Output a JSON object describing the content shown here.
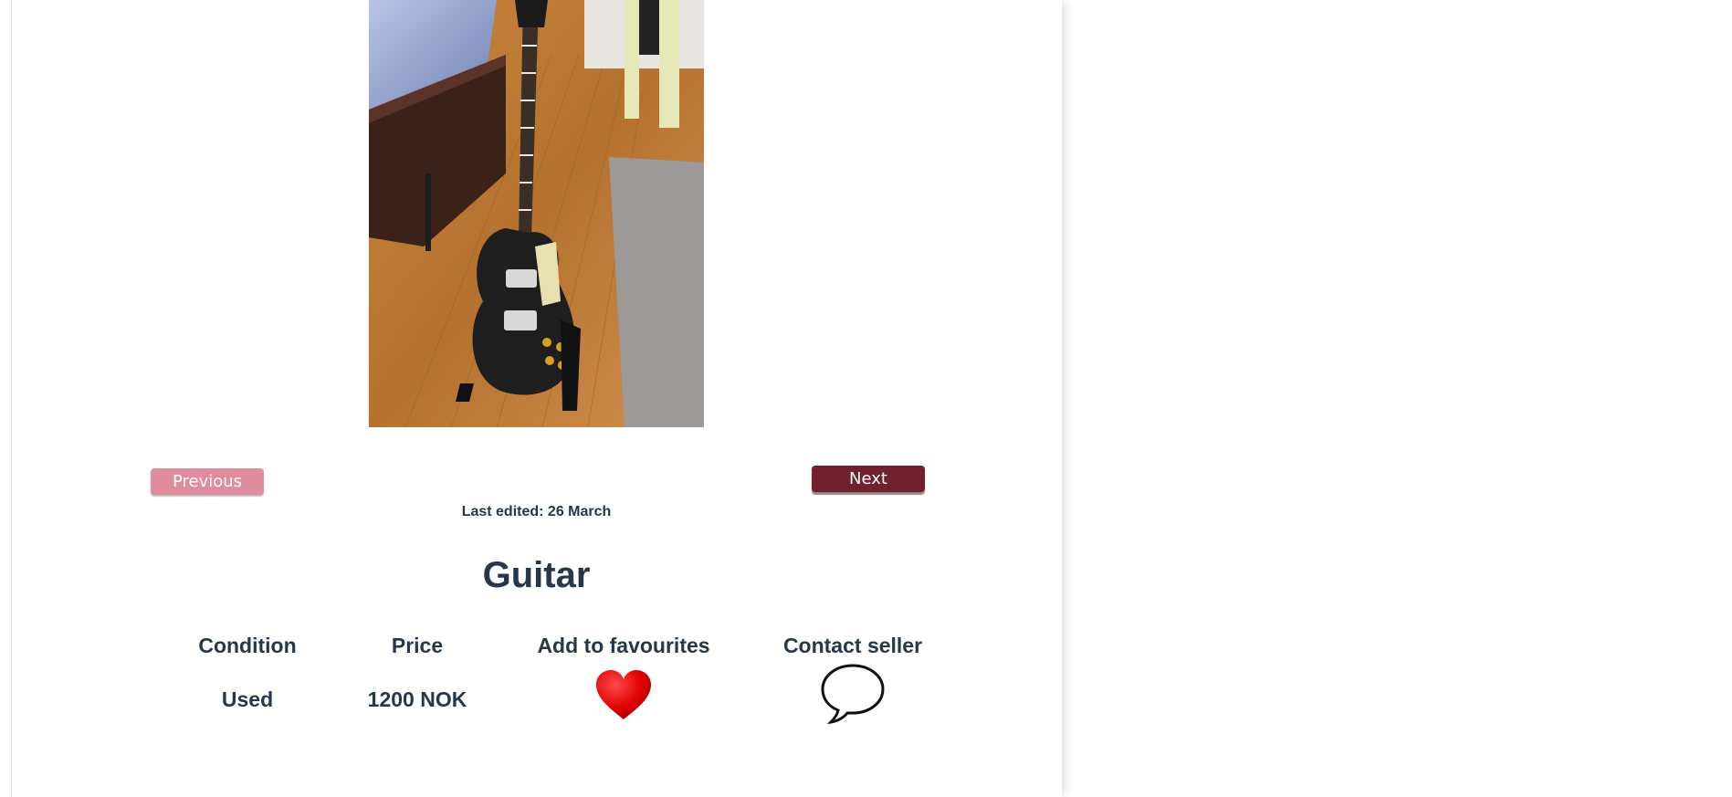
{
  "gallery": {
    "previous_label": "Previous",
    "next_label": "Next"
  },
  "listing": {
    "last_edited": "Last edited: 26 March",
    "title": "Guitar",
    "columns": {
      "condition_header": "Condition",
      "condition_value": "Used",
      "price_header": "Price",
      "price_value": "1200 NOK",
      "favourites_header": "Add to favourites",
      "contact_header": "Contact seller"
    }
  },
  "icons": {
    "favourite": "heart-icon",
    "contact": "speech-bubble-icon"
  },
  "colors": {
    "text": "#26374a",
    "next_button": "#72202e",
    "previous_button": "#e08c9c",
    "heart": "#e00000"
  }
}
